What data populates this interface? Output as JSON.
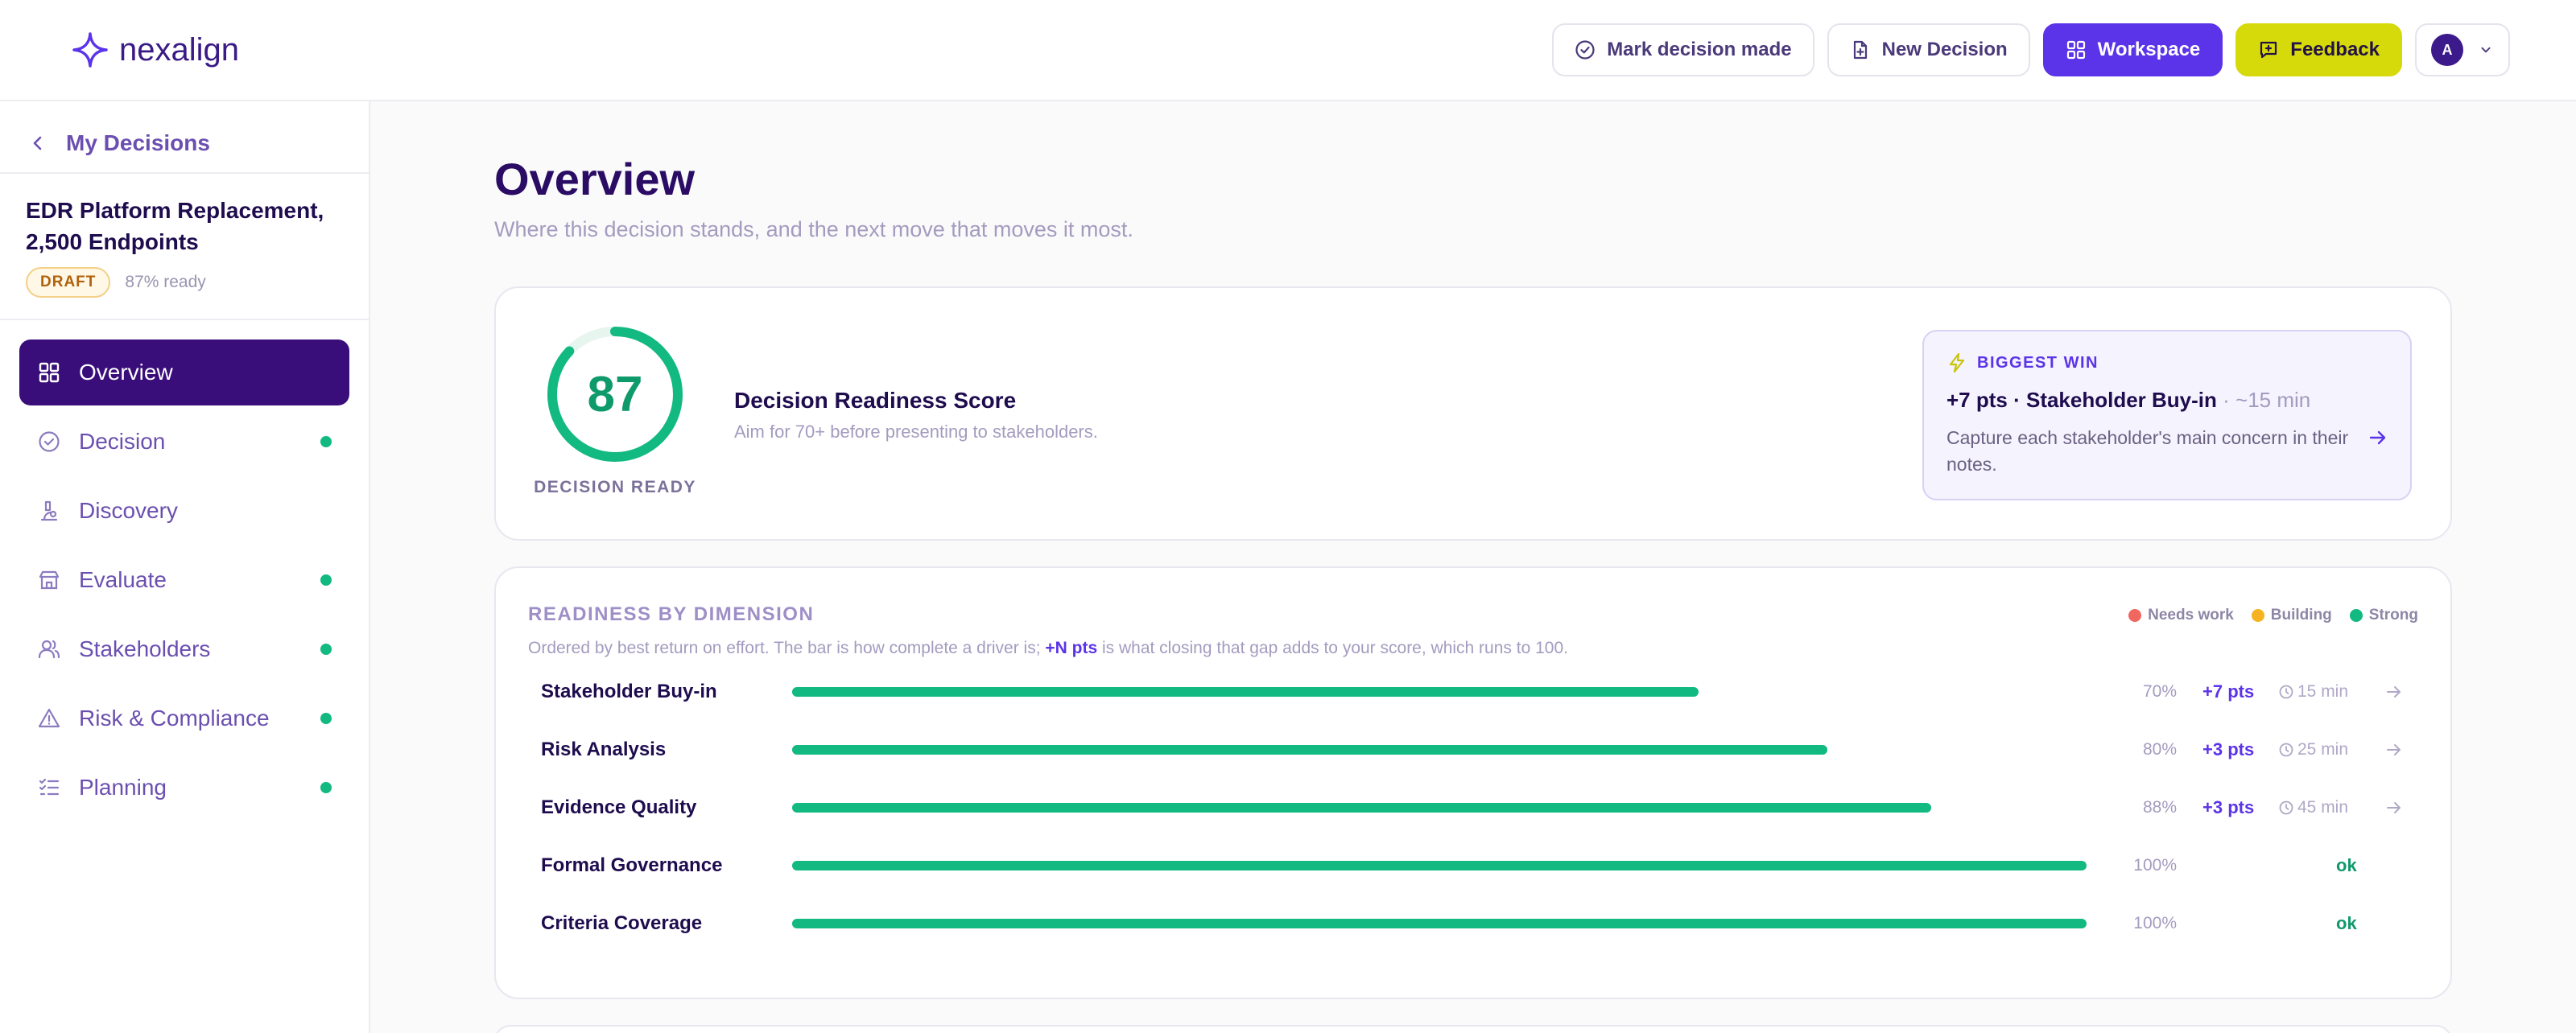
{
  "brand": {
    "name": "nexalign"
  },
  "topbar": {
    "mark_decision_label": "Mark decision made",
    "new_decision_label": "New Decision",
    "workspace_label": "Workspace",
    "feedback_label": "Feedback",
    "avatar_initial": "A"
  },
  "sidebar": {
    "back_label": "My Decisions",
    "decision_title": "EDR Platform Replacement, 2,500 Endpoints",
    "status_badge": "DRAFT",
    "ready_text": "87% ready",
    "items": [
      {
        "label": "Overview",
        "active": true,
        "dot": false,
        "icon": "grid-icon"
      },
      {
        "label": "Decision",
        "active": false,
        "dot": true,
        "icon": "check-circle-icon"
      },
      {
        "label": "Discovery",
        "active": false,
        "dot": false,
        "icon": "microscope-icon"
      },
      {
        "label": "Evaluate",
        "active": false,
        "dot": true,
        "icon": "store-icon"
      },
      {
        "label": "Stakeholders",
        "active": false,
        "dot": true,
        "icon": "users-icon"
      },
      {
        "label": "Risk & Compliance",
        "active": false,
        "dot": true,
        "icon": "warning-icon"
      },
      {
        "label": "Planning",
        "active": false,
        "dot": true,
        "icon": "checklist-icon"
      }
    ],
    "dot_color": "#12b980"
  },
  "main": {
    "title": "Overview",
    "subtitle": "Where this decision stands, and the next move that moves it most."
  },
  "score": {
    "value": 87,
    "display": "87",
    "max": 100,
    "label": "DECISION READY",
    "title": "Decision Readiness Score",
    "subtitle": "Aim for 70+ before presenting to stakeholders.",
    "color": "#12b980"
  },
  "biggest_win": {
    "heading": "BIGGEST WIN",
    "title": "+7 pts · Stakeholder Buy-in",
    "time": " · ~15 min",
    "description": "Capture each stakeholder's main concern in their notes."
  },
  "dimensions": {
    "heading": "READINESS BY DIMENSION",
    "sub_before": "Ordered by best return on effort. The bar is how complete a driver is; ",
    "sub_bold": "+N pts",
    "sub_after": " is what closing that gap adds to your score, which runs to 100.",
    "legend": [
      {
        "label": "Needs work",
        "color": "#f0675f"
      },
      {
        "label": "Building",
        "color": "#f5b321"
      },
      {
        "label": "Strong",
        "color": "#12b980"
      }
    ],
    "rows": [
      {
        "name": "Stakeholder Buy-in",
        "percent": 70,
        "percent_label": "70%",
        "pts": "+7 pts",
        "time": "15 min",
        "ok": ""
      },
      {
        "name": "Risk Analysis",
        "percent": 80,
        "percent_label": "80%",
        "pts": "+3 pts",
        "time": "25 min",
        "ok": ""
      },
      {
        "name": "Evidence Quality",
        "percent": 88,
        "percent_label": "88%",
        "pts": "+3 pts",
        "time": "45 min",
        "ok": ""
      },
      {
        "name": "Formal Governance",
        "percent": 100,
        "percent_label": "100%",
        "pts": "",
        "time": "",
        "ok": "ok"
      },
      {
        "name": "Criteria Coverage",
        "percent": 100,
        "percent_label": "100%",
        "pts": "",
        "time": "",
        "ok": "ok"
      }
    ]
  }
}
